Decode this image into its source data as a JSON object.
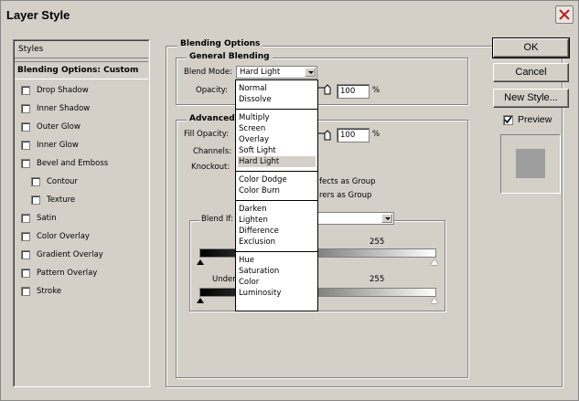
{
  "window": {
    "title": "Layer Style"
  },
  "left_panel": {
    "header": "Styles",
    "selected": "Blending Options: Custom",
    "items": [
      {
        "label": "Drop Shadow",
        "checked": false
      },
      {
        "label": "Inner Shadow",
        "checked": false
      },
      {
        "label": "Outer Glow",
        "checked": false
      },
      {
        "label": "Inner Glow",
        "checked": false
      },
      {
        "label": "Bevel and Emboss",
        "checked": false
      },
      {
        "label": "Contour",
        "checked": false
      },
      {
        "label": "Texture",
        "checked": false
      },
      {
        "label": "Satin",
        "checked": false
      },
      {
        "label": "Color Overlay",
        "checked": false
      },
      {
        "label": "Gradient Overlay",
        "checked": false
      },
      {
        "label": "Pattern Overlay",
        "checked": false
      },
      {
        "label": "Stroke",
        "checked": false
      }
    ]
  },
  "blending": {
    "title": "Blending Options",
    "general": {
      "title": "General Blending",
      "blend_mode_label": "Blend Mode:",
      "blend_mode_value": "Hard Light",
      "opacity_label": "Opacity:",
      "opacity_value": "100",
      "opacity_unit": "%"
    },
    "advanced": {
      "title": "Advanced",
      "fill_opacity_label": "Fill Opacity:",
      "fill_opacity_value": "100",
      "fill_opacity_unit": "%",
      "channels_label": "Channels:",
      "knockout_label": "Knockout:",
      "effects_group_partial": "fects as Group",
      "layers_group_partial": "rers as Group",
      "blend_if_label": "Blend If:",
      "this_layer_max": "255",
      "underlying_label_partial": "Under",
      "underlying_max": "255"
    }
  },
  "dropdown": {
    "groups": [
      [
        "Normal",
        "Dissolve"
      ],
      [
        "Multiply",
        "Screen",
        "Overlay",
        "Soft Light",
        "Hard Light"
      ],
      [
        "Color Dodge",
        "Color Burn"
      ],
      [
        "Darken",
        "Lighten",
        "Difference",
        "Exclusion"
      ],
      [
        "Hue",
        "Saturation",
        "Color",
        "Luminosity"
      ]
    ],
    "highlighted": "Hard Light"
  },
  "buttons": {
    "ok": "OK",
    "cancel": "Cancel",
    "new_style": "New Style...",
    "preview_label": "Preview",
    "preview_checked": true
  }
}
